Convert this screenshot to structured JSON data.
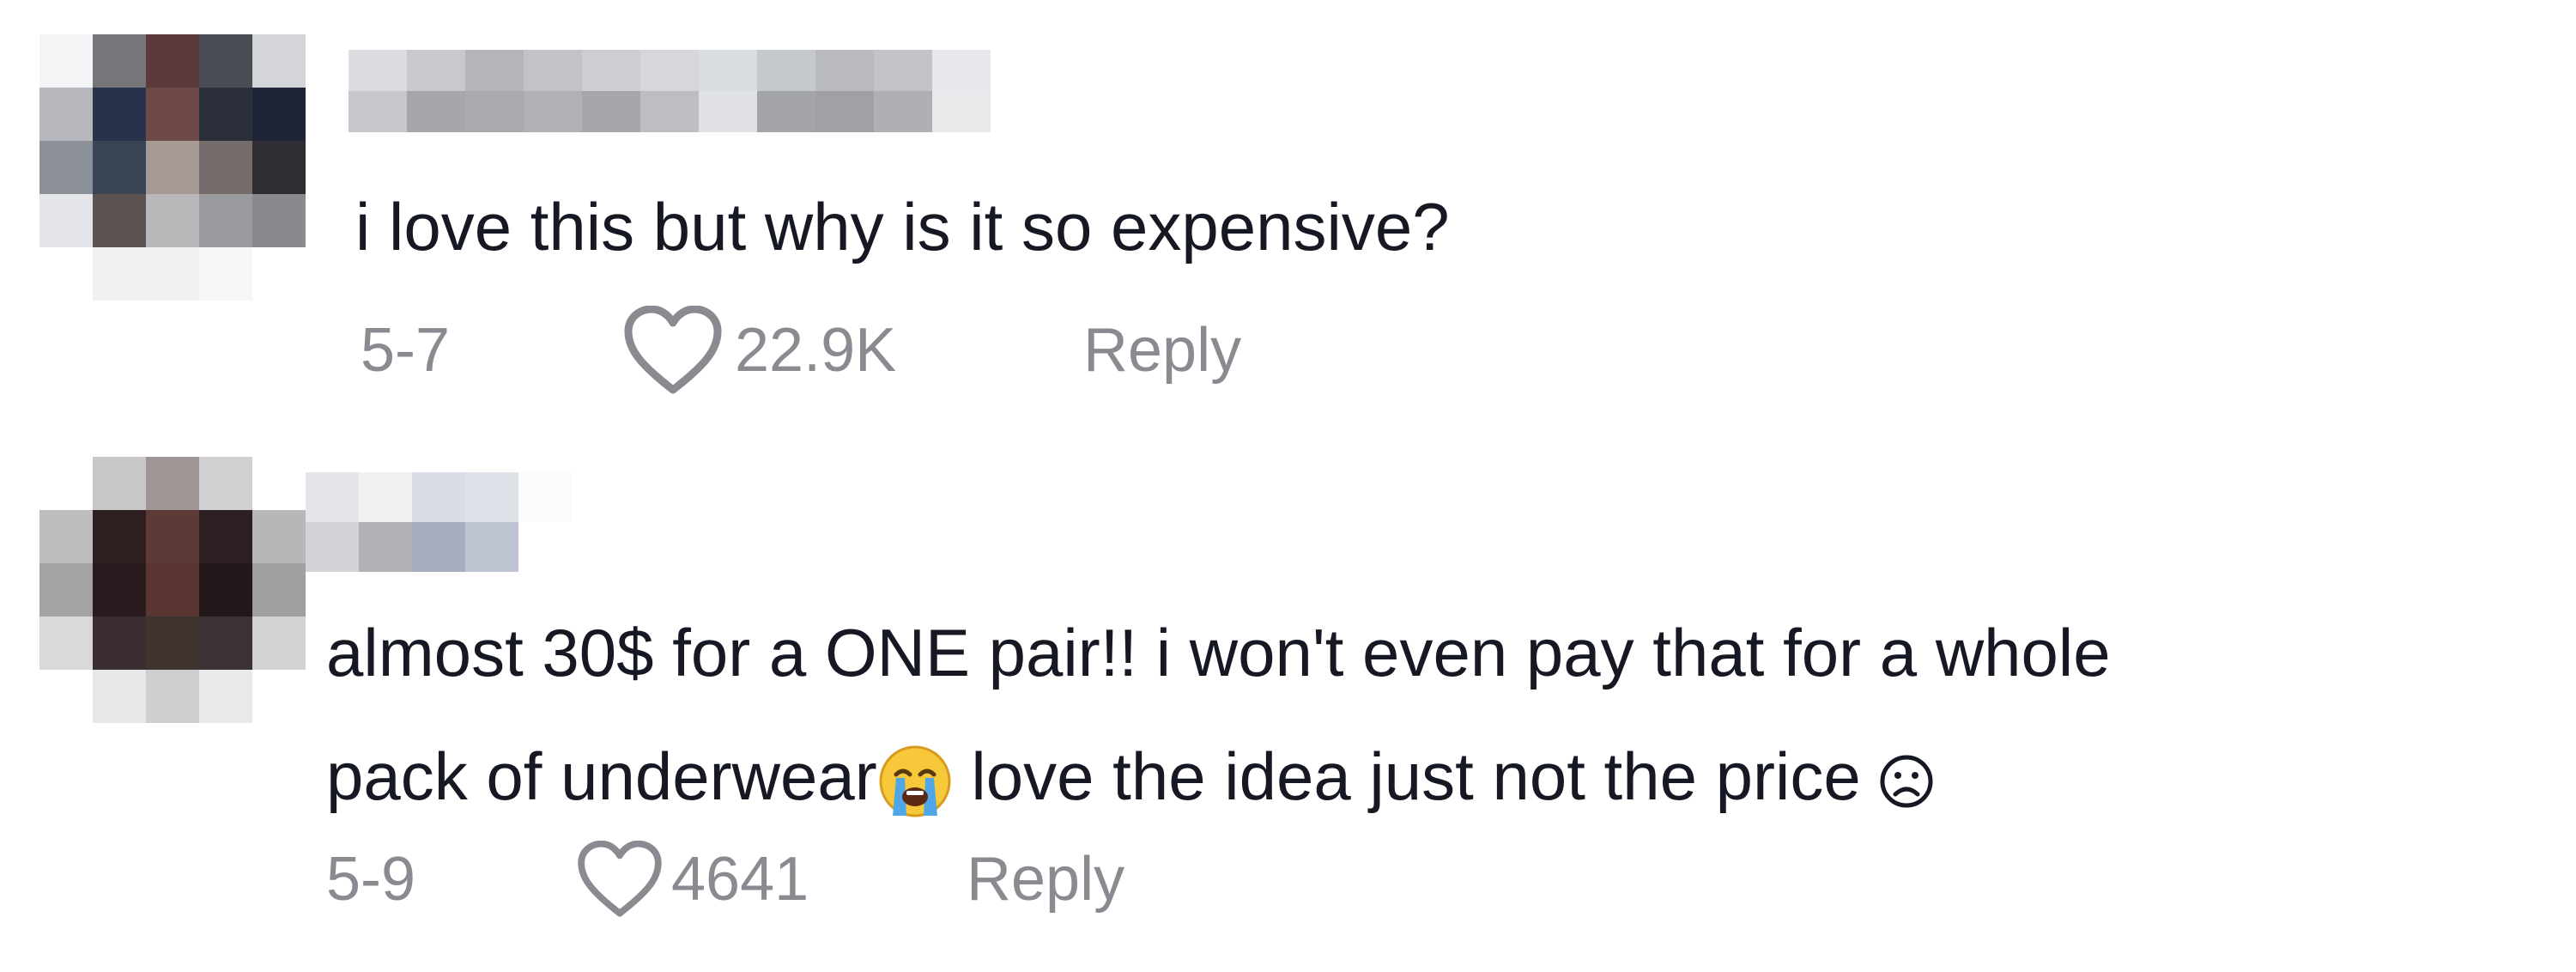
{
  "comments": [
    {
      "text_lines": [
        "i love this but why is it so expensive?"
      ],
      "date": "5-7",
      "likes": "22.9K",
      "reply_label": "Reply",
      "avatar_pixels": [
        [
          "#f3f4f6",
          "#76767a",
          "#5b3a3c",
          "#4b4d55",
          "#d4d5d9"
        ],
        [
          "#b6b8be",
          "#27334a",
          "#6d4a47",
          "#2b2f3a",
          "#1f2437"
        ],
        [
          "#8c9098",
          "#3b4452",
          "#a59a94",
          "#746d6c",
          "#2e2e33"
        ],
        [
          "#e4e5ea",
          "#5d5353",
          "#b9b8bb",
          "#9c9ca0",
          "#8a8a8e"
        ],
        [
          "#ffffff",
          "#f1f1f3",
          "#f1f1f3",
          "#f6f6f7",
          "#ffffff"
        ]
      ],
      "username_pixels": [
        [
          "#dcdde1",
          "#c8c9cd",
          "#b4b5b9",
          "#c2c3c7",
          "#cdced2",
          "#d6d7db",
          "#d9dde2",
          "#c5c8cd",
          "#b8babf",
          "#c1c3c7",
          "#e6e7ea"
        ],
        [
          "#c7c8cc",
          "#a6a7ab",
          "#a9aaae",
          "#b0b1b5",
          "#a6a7ab",
          "#bdbec2",
          "#dfe1e4",
          "#a3a5a9",
          "#9fa1a5",
          "#aeb0b4",
          "#e8e9eb"
        ]
      ]
    },
    {
      "text_lines": [
        "almost 30$ for a ONE pair!! i won't even pay that for a whole",
        "pack of underwear"
      ],
      "text_line2_tail": " love the idea just not the price ",
      "date": "5-9",
      "likes": "4641",
      "reply_label": "Reply",
      "avatar_pixels": [
        [
          "#ffffff",
          "#c9c7c8",
          "#9e9594",
          "#d1d0d2",
          "#ffffff"
        ],
        [
          "#bdbdc0",
          "#2d1e20",
          "#5c3b36",
          "#2b1f22",
          "#b7b6b9"
        ],
        [
          "#a3a2a5",
          "#2a1c1e",
          "#5a3632",
          "#22171a",
          "#a09fa2"
        ],
        [
          "#d9d8db",
          "#3b2e30",
          "#3f3330",
          "#3c3133",
          "#d2d1d4"
        ],
        [
          "#ffffff",
          "#e7e6e8",
          "#cfcdcf",
          "#e9e8ea",
          "#ffffff"
        ]
      ],
      "username_pixels": [
        [
          "#e4e5e9",
          "#eef0f2",
          "#d9dde6",
          "#dee1e8",
          "#fafbfc"
        ],
        [
          "#d2d3d7",
          "#b1b2b6",
          "#a8adbe",
          "#bfc4d2",
          "#ffffff"
        ]
      ]
    }
  ],
  "colors": {
    "primary_text": "#161823",
    "secondary_text": "#8a8b91"
  },
  "icons": [
    "heart-icon",
    "loudly-crying-face-emoji-icon",
    "frowning-face-icon"
  ]
}
